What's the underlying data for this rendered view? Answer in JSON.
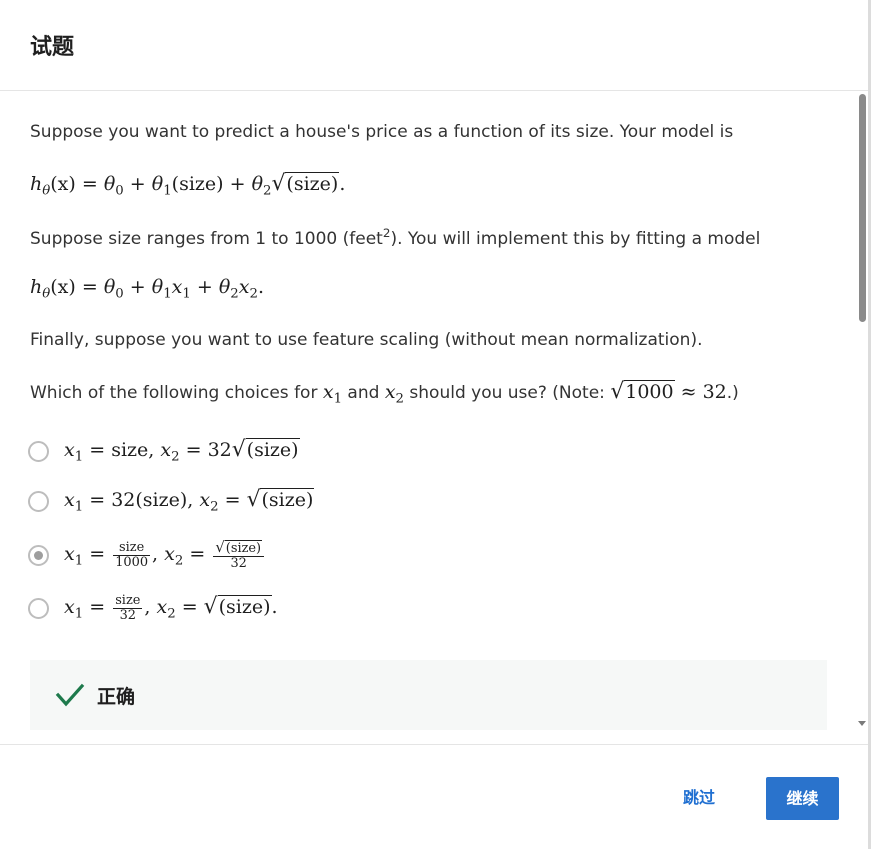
{
  "header": {
    "title": "试题"
  },
  "question": {
    "intro": "Suppose you want to predict a house's price as a function of its size. Your model is",
    "model_eq": {
      "lhs": "h",
      "theta_sub": "θ",
      "arg": "(x)",
      "eq": " = ",
      "t0": "θ",
      "t0_sub": "0",
      "plus1": " + ",
      "t1": "θ",
      "t1_sub": "1",
      "size_term": "(size)",
      "plus2": " + ",
      "t2": "θ",
      "t2_sub": "2",
      "sqrt_arg": "(size)",
      "end": "."
    },
    "range_a": "Suppose size ranges from 1 to 1000 (feet",
    "range_sup": "2",
    "range_b": "). You will implement this by fitting a model",
    "fit_eq": {
      "lhs": "h",
      "theta_sub": "θ",
      "arg": "(x)",
      "eq": " = ",
      "t0": "θ",
      "t0_sub": "0",
      "plus1": " + ",
      "t1": "θ",
      "t1_sub": "1",
      "x1": "x",
      "x1_sub": "1",
      "plus2": " + ",
      "t2": "θ",
      "t2_sub": "2",
      "x2": "x",
      "x2_sub": "2",
      "end": "."
    },
    "scaling": "Finally, suppose you want to use feature scaling (without mean normalization).",
    "which_a": "Which of the following choices for ",
    "which_x": "x",
    "which_x1_sub": "1",
    "which_and": " and ",
    "which_x2_sub": "2",
    "which_b": " should you use? (Note: ",
    "note_sqrt": "1000",
    "note_approx": " ≈ 32",
    "which_c": ".)"
  },
  "options": [
    {
      "x": "x",
      "s1": "1",
      "eq": " = ",
      "v1": "size",
      "comma": ",  ",
      "s2": "2",
      "coef": "32",
      "sqrt": "(size)",
      "selected": false
    },
    {
      "x": "x",
      "s1": "1",
      "eq": " = ",
      "v1": "32(size)",
      "comma": ",  ",
      "s2": "2",
      "sqrt": "(size)",
      "selected": false
    },
    {
      "x": "x",
      "s1": "1",
      "eq": " = ",
      "frac_num": "size",
      "frac_den": "1000",
      "comma": ",  ",
      "s2": "2",
      "frac2_sqrt": "(size)",
      "frac2_den": "32",
      "selected": true
    },
    {
      "x": "x",
      "s1": "1",
      "eq": " = ",
      "frac_num": "size",
      "frac_den": "32",
      "comma": ",  ",
      "s2": "2",
      "sqrt": "(size)",
      "end": ".",
      "selected": false
    }
  ],
  "feedback": {
    "label": "正确",
    "accent": "#1e7a4c"
  },
  "footer": {
    "skip_label": "跳过",
    "continue_label": "继续",
    "accent": "#2a73cc"
  }
}
